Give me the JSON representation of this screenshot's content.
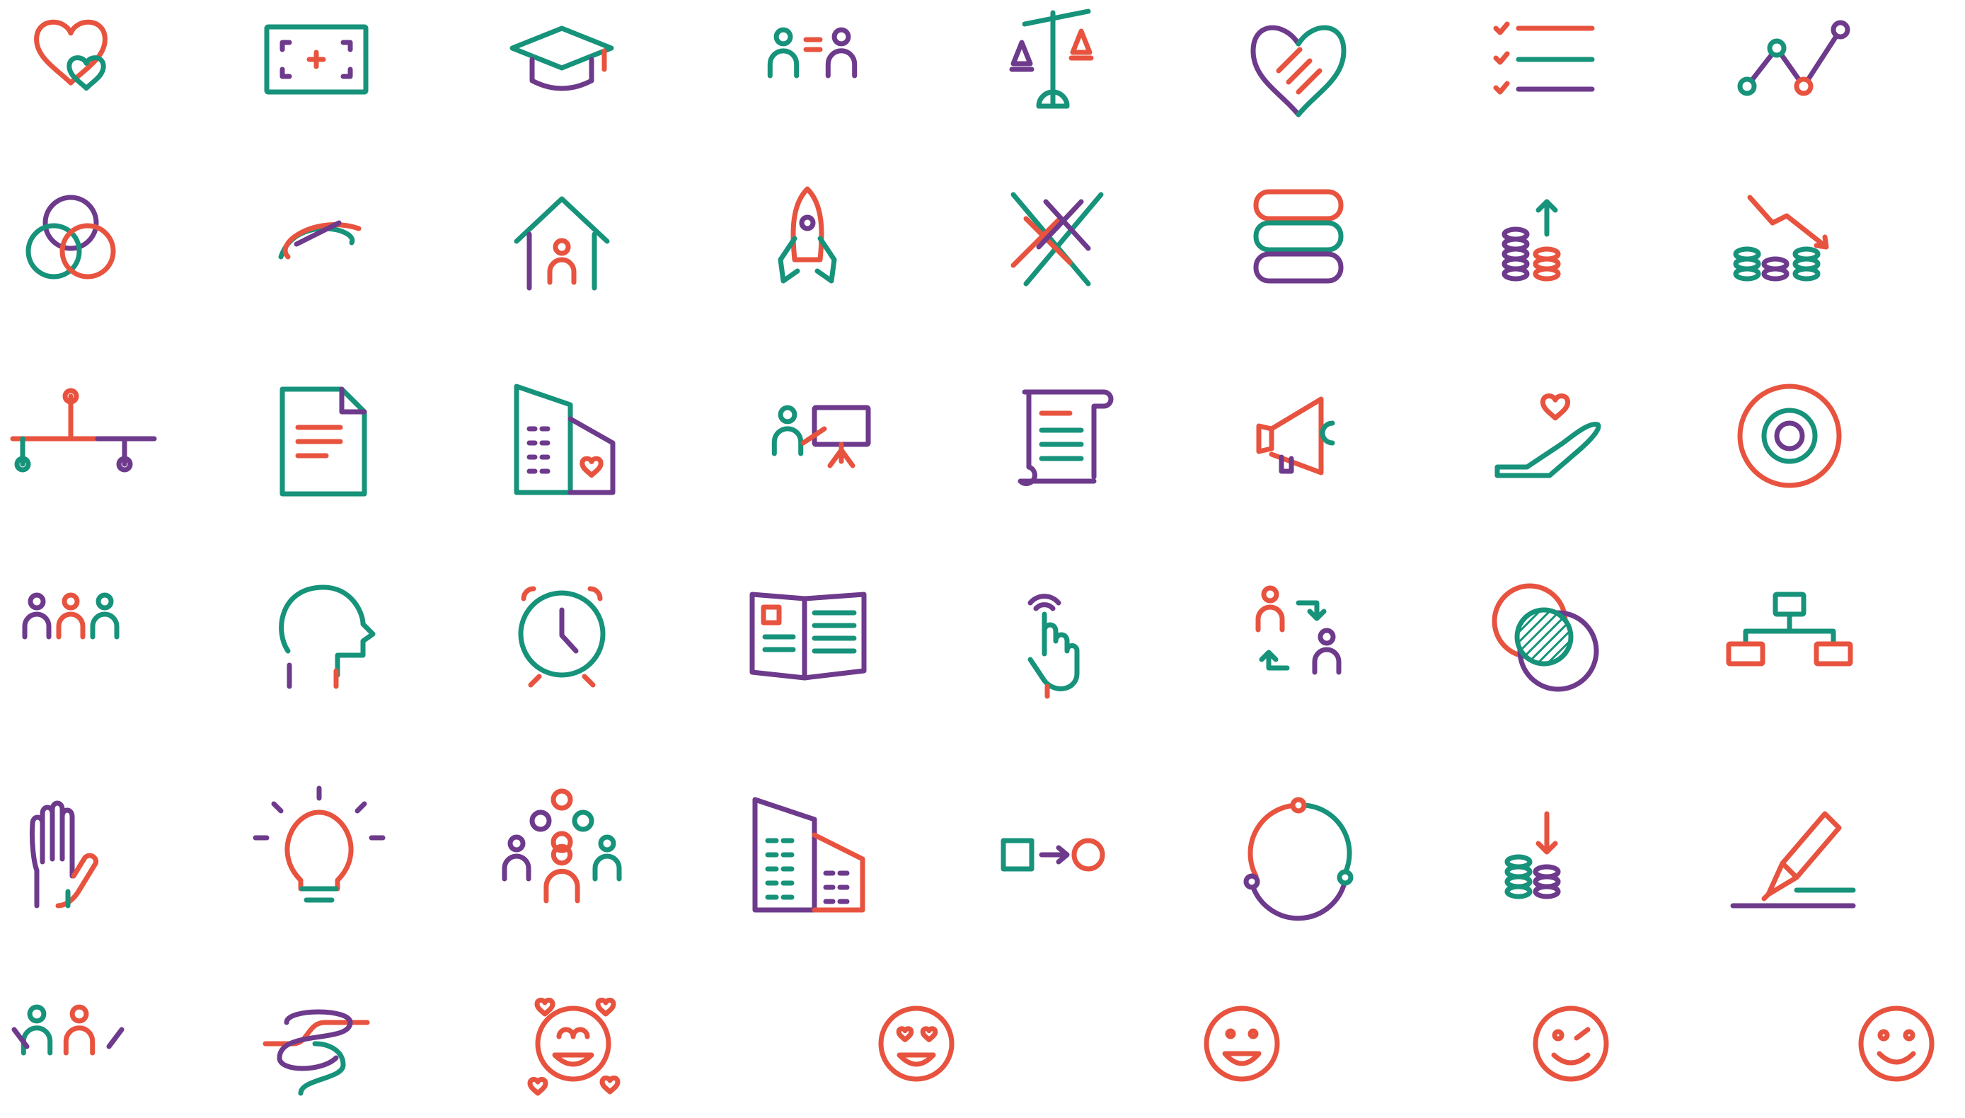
{
  "colors": {
    "red": "#e8533f",
    "green": "#16937a",
    "purple": "#6d3a8c",
    "background": "#ffffff"
  },
  "icons": [
    "heart-in-heart-icon",
    "medical-screen-icon",
    "graduation-cap-icon",
    "equal-people-icon",
    "balance-scale-icon",
    "handshake-heart-icon",
    "checklist-icon",
    "line-graph-icon",
    "venn-circles-icon",
    "infinity-link-icon",
    "house-person-icon",
    "rocket-icon",
    "crossed-lines-icon",
    "stacked-books-icon",
    "coins-increase-icon",
    "coins-decrease-icon",
    "timeline-branch-icon",
    "document-icon",
    "buildings-heart-icon",
    "presentation-icon",
    "scroll-document-icon",
    "megaphone-icon",
    "hand-heart-icon",
    "target-icon",
    "three-people-icon",
    "head-profile-icon",
    "alarm-clock-icon",
    "open-book-icon",
    "tap-finger-icon",
    "exchange-people-icon",
    "overlap-circles-icon",
    "org-chart-icon",
    "raised-hand-icon",
    "lightbulb-icon",
    "team-group-icon",
    "office-buildings-icon",
    "process-flow-icon",
    "cycle-icon",
    "coins-download-icon",
    "pencil-sign-icon",
    "people-hug-icon",
    "tangled-path-icon",
    "love-face-icon",
    "heart-eyes-emoji-icon",
    "grin-emoji-icon",
    "wink-emoji-icon",
    "smile-emoji-icon"
  ]
}
